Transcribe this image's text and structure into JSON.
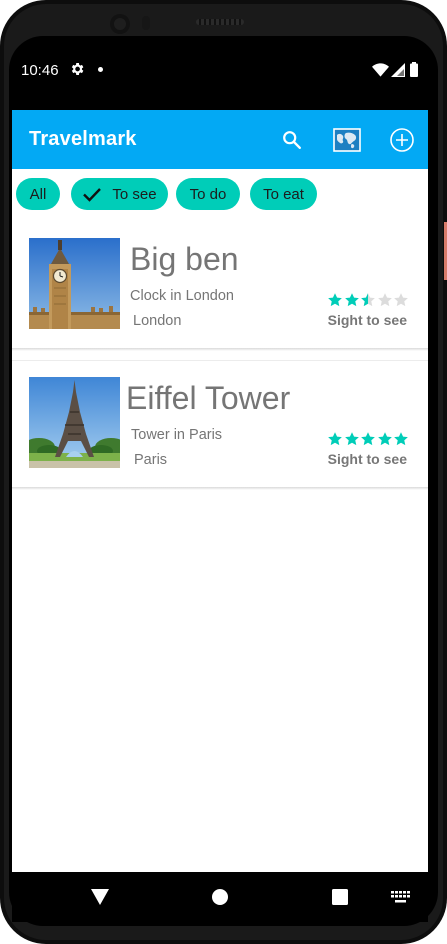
{
  "status_bar": {
    "time": "10:46",
    "icons": [
      "gear-icon",
      "notification-dot-icon",
      "wifi-icon",
      "signal-icon",
      "battery-icon"
    ]
  },
  "app_bar": {
    "title": "Travelmark",
    "color": "#03a9f4",
    "actions": [
      "search-icon",
      "map-icon",
      "add-circle-icon"
    ]
  },
  "filters": {
    "accent": "#00cdb8",
    "chips": [
      {
        "label": "All",
        "selected": false
      },
      {
        "label": "To see",
        "selected": true
      },
      {
        "label": "To do",
        "selected": false
      },
      {
        "label": "To eat",
        "selected": false
      }
    ]
  },
  "places": [
    {
      "title": "Big ben",
      "subtitle": "Clock in London",
      "location": "London",
      "rating": 2.5,
      "rating_max": 5,
      "category": "Sight to see",
      "image": "big-ben-photo"
    },
    {
      "title": "Eiffel Tower",
      "subtitle": "Tower in Paris",
      "location": "Paris",
      "rating": 5,
      "rating_max": 5,
      "category": "Sight to see",
      "image": "eiffel-tower-photo"
    }
  ],
  "nav_bar": {
    "buttons": [
      "back-icon",
      "home-icon",
      "recents-icon",
      "keyboard-icon"
    ]
  }
}
